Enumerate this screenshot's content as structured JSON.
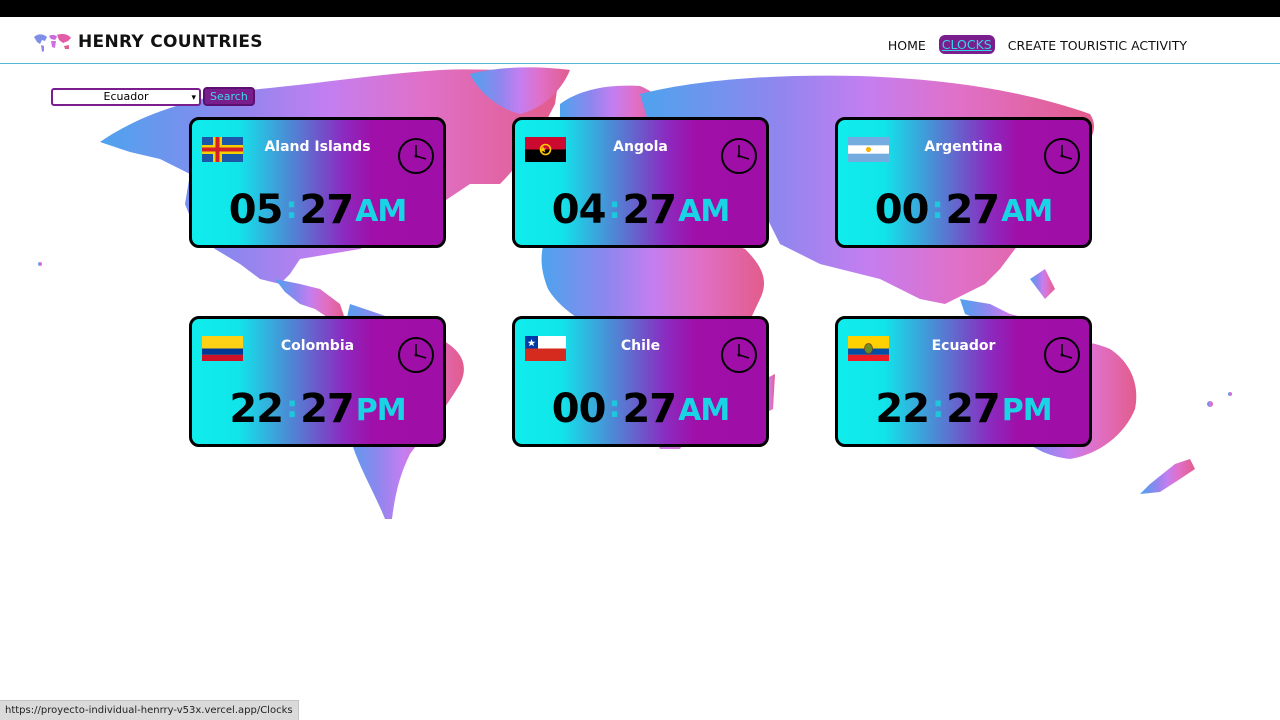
{
  "brand": {
    "title": "HENRY COUNTRIES",
    "icon": "world-map-logo"
  },
  "nav": [
    {
      "label": "HOME",
      "active": false
    },
    {
      "label": "CLOCKS",
      "active": true
    },
    {
      "label": "CREATE TOURISTIC ACTIVITY",
      "active": false
    }
  ],
  "search": {
    "selected": "Ecuador",
    "button_label": "Search"
  },
  "clocks": [
    {
      "country": "Aland Islands",
      "hours": "05",
      "minutes": "27",
      "ampm": "AM"
    },
    {
      "country": "Angola",
      "hours": "04",
      "minutes": "27",
      "ampm": "AM"
    },
    {
      "country": "Argentina",
      "hours": "00",
      "minutes": "27",
      "ampm": "AM"
    },
    {
      "country": "Colombia",
      "hours": "22",
      "minutes": "27",
      "ampm": "PM"
    },
    {
      "country": "Chile",
      "hours": "00",
      "minutes": "27",
      "ampm": "AM"
    },
    {
      "country": "Ecuador",
      "hours": "22",
      "minutes": "27",
      "ampm": "PM"
    }
  ],
  "time_separator": ":",
  "status_url": "https://proyecto-individual-henrry-v53x.vercel.app/Clocks",
  "colors": {
    "accent_purple": "#7a1e8e",
    "accent_cyan": "#18d4e4",
    "card_gradient_start": "#10ecec",
    "card_gradient_end": "#a00ea8",
    "nav_underline": "#53b7d3"
  }
}
